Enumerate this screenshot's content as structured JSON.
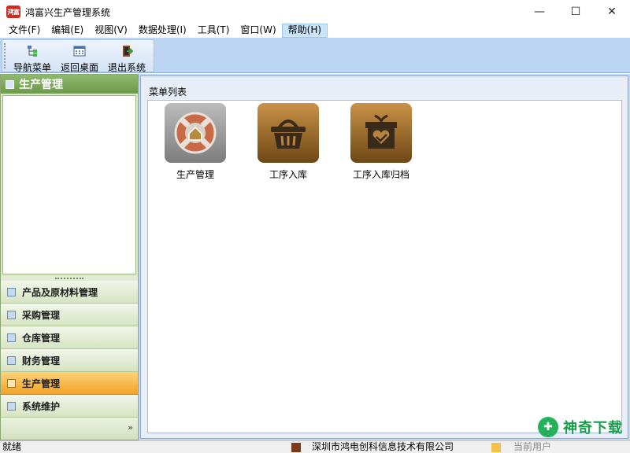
{
  "window": {
    "icon_text": "鸿富",
    "title": "鸿富兴生产管理系统",
    "controls": [
      "—",
      "☐",
      "✕"
    ]
  },
  "menubar": {
    "items": [
      "文件(F)",
      "编辑(E)",
      "视图(V)",
      "数据处理(I)",
      "工具(T)",
      "窗口(W)",
      "帮助(H)"
    ],
    "active": "帮助(H)"
  },
  "toolbar": {
    "buttons": [
      {
        "label": "导航菜单",
        "icon": "navigation-icon"
      },
      {
        "label": "返回桌面",
        "icon": "desktop-icon"
      },
      {
        "label": "退出系统",
        "icon": "exit-icon"
      }
    ]
  },
  "left_panel": {
    "title": "生产管理",
    "nav_items": [
      "产品及原材料管理",
      "采购管理",
      "仓库管理",
      "财务管理",
      "生产管理",
      "系统维护"
    ],
    "active_item": "生产管理",
    "footer_chevron": "»"
  },
  "main_panel": {
    "title": "菜单列表",
    "tiles": [
      {
        "label": "生产管理",
        "icon": "lifebuoy-home-icon"
      },
      {
        "label": "工序入库",
        "icon": "basket-icon"
      },
      {
        "label": "工序入库归档",
        "icon": "gift-box-check-icon"
      }
    ]
  },
  "statusbar": {
    "status": "就绪",
    "company": "深圳市鸿电创科信息技术有限公司",
    "user": "当前用户"
  },
  "watermark": {
    "text": "神奇下载"
  },
  "colors": {
    "toolbar_bg": "#bcd5f2",
    "panel_header": "#7aa656",
    "nav_active": "#f6b13a",
    "tile_brown": "#9a6a2c"
  }
}
